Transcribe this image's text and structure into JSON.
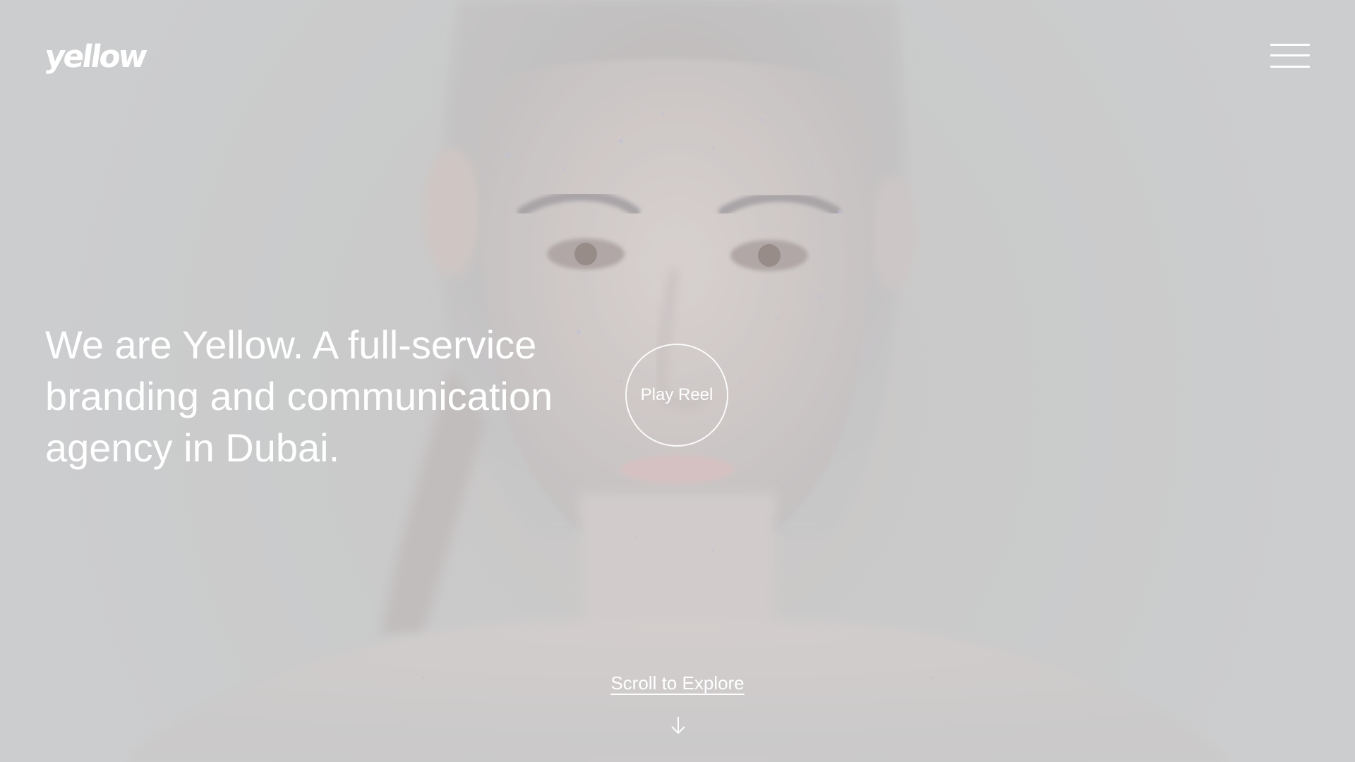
{
  "brand": {
    "logo_text": "yellow"
  },
  "header": {
    "menu_icon": "hamburger-menu-icon"
  },
  "hero": {
    "headline": "We are Yellow. A full-service branding and communication agency in Dubai.",
    "play_reel_label": "Play Reel",
    "scroll_label": "Scroll to Explore",
    "scroll_icon": "arrow-down-icon"
  },
  "colors": {
    "text": "#ffffff",
    "background": "#c9cacb"
  }
}
